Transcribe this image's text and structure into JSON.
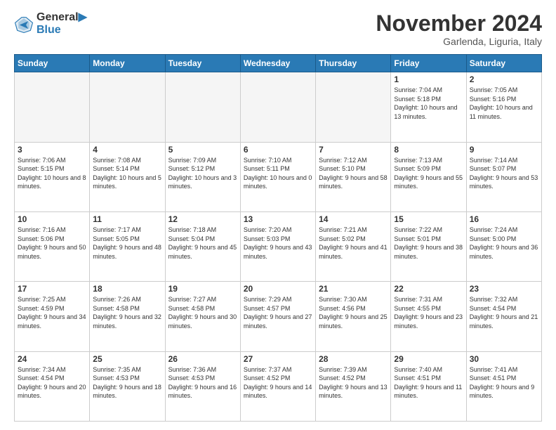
{
  "header": {
    "logo_general": "General",
    "logo_blue": "Blue",
    "month_title": "November 2024",
    "location": "Garlenda, Liguria, Italy"
  },
  "weekdays": [
    "Sunday",
    "Monday",
    "Tuesday",
    "Wednesday",
    "Thursday",
    "Friday",
    "Saturday"
  ],
  "weeks": [
    [
      {
        "day": "",
        "info": ""
      },
      {
        "day": "",
        "info": ""
      },
      {
        "day": "",
        "info": ""
      },
      {
        "day": "",
        "info": ""
      },
      {
        "day": "",
        "info": ""
      },
      {
        "day": "1",
        "info": "Sunrise: 7:04 AM\nSunset: 5:18 PM\nDaylight: 10 hours and 13 minutes."
      },
      {
        "day": "2",
        "info": "Sunrise: 7:05 AM\nSunset: 5:16 PM\nDaylight: 10 hours and 11 minutes."
      }
    ],
    [
      {
        "day": "3",
        "info": "Sunrise: 7:06 AM\nSunset: 5:15 PM\nDaylight: 10 hours and 8 minutes."
      },
      {
        "day": "4",
        "info": "Sunrise: 7:08 AM\nSunset: 5:14 PM\nDaylight: 10 hours and 5 minutes."
      },
      {
        "day": "5",
        "info": "Sunrise: 7:09 AM\nSunset: 5:12 PM\nDaylight: 10 hours and 3 minutes."
      },
      {
        "day": "6",
        "info": "Sunrise: 7:10 AM\nSunset: 5:11 PM\nDaylight: 10 hours and 0 minutes."
      },
      {
        "day": "7",
        "info": "Sunrise: 7:12 AM\nSunset: 5:10 PM\nDaylight: 9 hours and 58 minutes."
      },
      {
        "day": "8",
        "info": "Sunrise: 7:13 AM\nSunset: 5:09 PM\nDaylight: 9 hours and 55 minutes."
      },
      {
        "day": "9",
        "info": "Sunrise: 7:14 AM\nSunset: 5:07 PM\nDaylight: 9 hours and 53 minutes."
      }
    ],
    [
      {
        "day": "10",
        "info": "Sunrise: 7:16 AM\nSunset: 5:06 PM\nDaylight: 9 hours and 50 minutes."
      },
      {
        "day": "11",
        "info": "Sunrise: 7:17 AM\nSunset: 5:05 PM\nDaylight: 9 hours and 48 minutes."
      },
      {
        "day": "12",
        "info": "Sunrise: 7:18 AM\nSunset: 5:04 PM\nDaylight: 9 hours and 45 minutes."
      },
      {
        "day": "13",
        "info": "Sunrise: 7:20 AM\nSunset: 5:03 PM\nDaylight: 9 hours and 43 minutes."
      },
      {
        "day": "14",
        "info": "Sunrise: 7:21 AM\nSunset: 5:02 PM\nDaylight: 9 hours and 41 minutes."
      },
      {
        "day": "15",
        "info": "Sunrise: 7:22 AM\nSunset: 5:01 PM\nDaylight: 9 hours and 38 minutes."
      },
      {
        "day": "16",
        "info": "Sunrise: 7:24 AM\nSunset: 5:00 PM\nDaylight: 9 hours and 36 minutes."
      }
    ],
    [
      {
        "day": "17",
        "info": "Sunrise: 7:25 AM\nSunset: 4:59 PM\nDaylight: 9 hours and 34 minutes."
      },
      {
        "day": "18",
        "info": "Sunrise: 7:26 AM\nSunset: 4:58 PM\nDaylight: 9 hours and 32 minutes."
      },
      {
        "day": "19",
        "info": "Sunrise: 7:27 AM\nSunset: 4:58 PM\nDaylight: 9 hours and 30 minutes."
      },
      {
        "day": "20",
        "info": "Sunrise: 7:29 AM\nSunset: 4:57 PM\nDaylight: 9 hours and 27 minutes."
      },
      {
        "day": "21",
        "info": "Sunrise: 7:30 AM\nSunset: 4:56 PM\nDaylight: 9 hours and 25 minutes."
      },
      {
        "day": "22",
        "info": "Sunrise: 7:31 AM\nSunset: 4:55 PM\nDaylight: 9 hours and 23 minutes."
      },
      {
        "day": "23",
        "info": "Sunrise: 7:32 AM\nSunset: 4:54 PM\nDaylight: 9 hours and 21 minutes."
      }
    ],
    [
      {
        "day": "24",
        "info": "Sunrise: 7:34 AM\nSunset: 4:54 PM\nDaylight: 9 hours and 20 minutes."
      },
      {
        "day": "25",
        "info": "Sunrise: 7:35 AM\nSunset: 4:53 PM\nDaylight: 9 hours and 18 minutes."
      },
      {
        "day": "26",
        "info": "Sunrise: 7:36 AM\nSunset: 4:53 PM\nDaylight: 9 hours and 16 minutes."
      },
      {
        "day": "27",
        "info": "Sunrise: 7:37 AM\nSunset: 4:52 PM\nDaylight: 9 hours and 14 minutes."
      },
      {
        "day": "28",
        "info": "Sunrise: 7:39 AM\nSunset: 4:52 PM\nDaylight: 9 hours and 13 minutes."
      },
      {
        "day": "29",
        "info": "Sunrise: 7:40 AM\nSunset: 4:51 PM\nDaylight: 9 hours and 11 minutes."
      },
      {
        "day": "30",
        "info": "Sunrise: 7:41 AM\nSunset: 4:51 PM\nDaylight: 9 hours and 9 minutes."
      }
    ]
  ]
}
